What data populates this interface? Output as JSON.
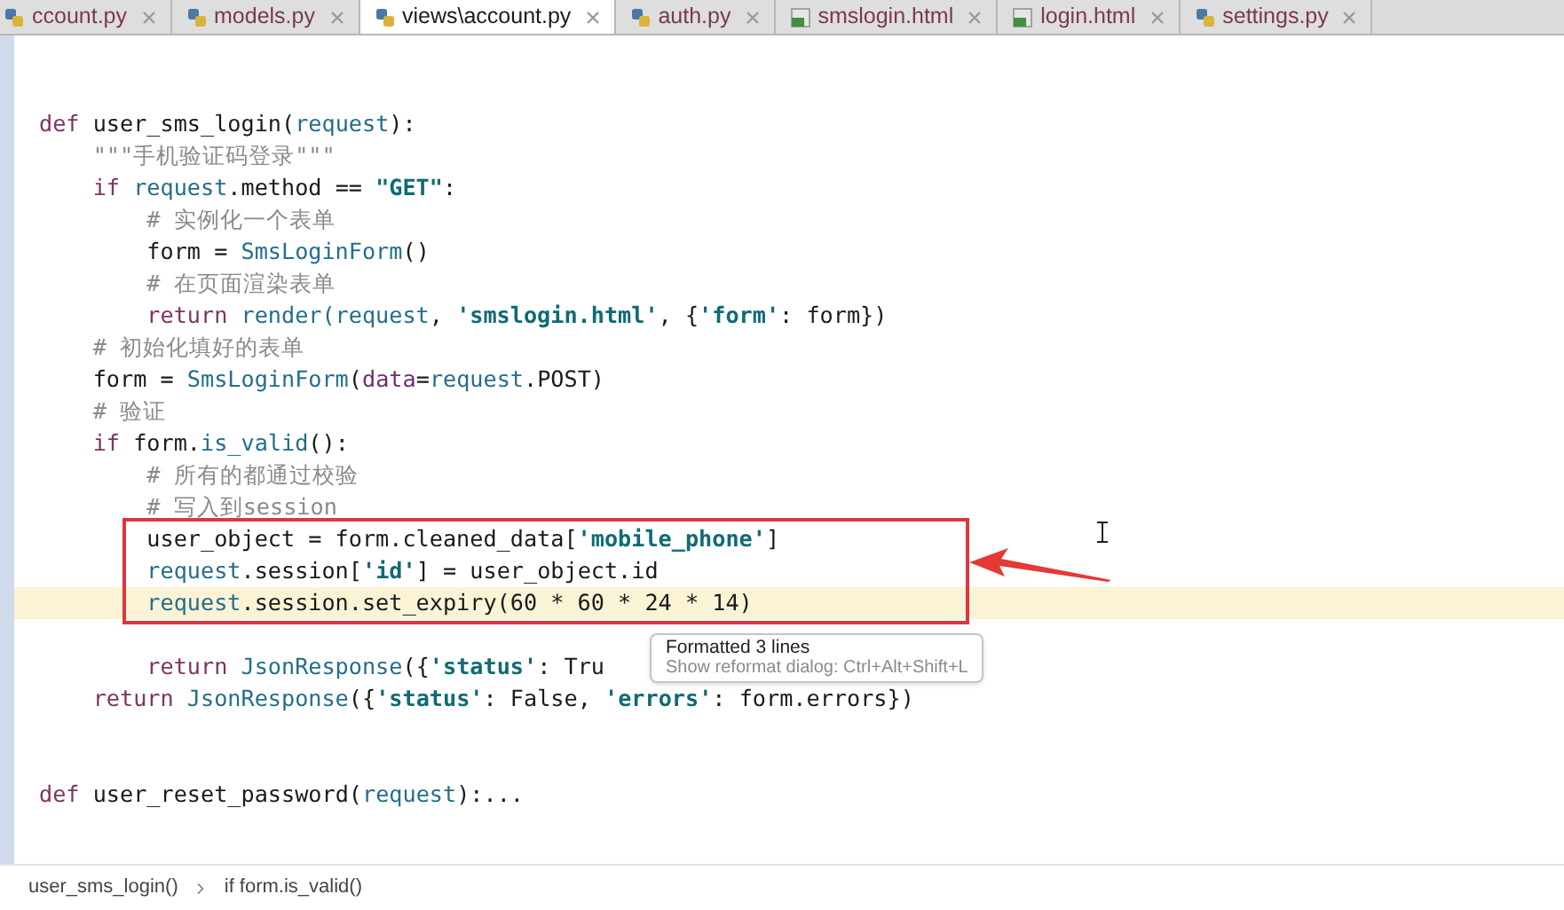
{
  "tabs": [
    {
      "label": "ccount.py",
      "selected": false,
      "kind": "python"
    },
    {
      "label": "models.py",
      "selected": false,
      "kind": "python"
    },
    {
      "label": "views\\account.py",
      "selected": true,
      "kind": "python"
    },
    {
      "label": "auth.py",
      "selected": false,
      "kind": "python"
    },
    {
      "label": "smslogin.html",
      "selected": false,
      "kind": "html"
    },
    {
      "label": "login.html",
      "selected": false,
      "kind": "html"
    },
    {
      "label": "settings.py",
      "selected": false,
      "kind": "python"
    }
  ],
  "editor": {
    "lines": [
      {
        "kind": "blank"
      },
      {
        "kind": "blank"
      },
      {
        "kind": "code",
        "tokens": [
          {
            "kind": "kw",
            "text": "def "
          },
          {
            "kind": "plain",
            "text": "user_sms_login("
          },
          {
            "kind": "name",
            "text": "request"
          },
          {
            "kind": "plain",
            "text": "):"
          }
        ],
        "current": false,
        "boxed": false
      },
      {
        "kind": "code",
        "tokens": [
          {
            "kind": "comment",
            "text": "    \"\"\"手机验证码登录\"\"\""
          }
        ],
        "current": false,
        "boxed": false
      },
      {
        "kind": "code",
        "tokens": [
          {
            "kind": "kw",
            "text": "    if "
          },
          {
            "kind": "name",
            "text": "request"
          },
          {
            "kind": "plain",
            "text": ".method == "
          },
          {
            "kind": "str",
            "text": "\"GET\""
          },
          {
            "kind": "plain",
            "text": ":"
          }
        ],
        "current": false,
        "boxed": false
      },
      {
        "kind": "code",
        "tokens": [
          {
            "kind": "comment",
            "text": "        # 实例化一个表单"
          }
        ],
        "current": false,
        "boxed": false
      },
      {
        "kind": "code",
        "tokens": [
          {
            "kind": "plain",
            "text": "        form = "
          },
          {
            "kind": "name",
            "text": "SmsLoginForm"
          },
          {
            "kind": "plain",
            "text": "()"
          }
        ],
        "current": false,
        "boxed": false
      },
      {
        "kind": "code",
        "tokens": [
          {
            "kind": "comment",
            "text": "        # 在页面渲染表单"
          }
        ],
        "current": false,
        "boxed": false
      },
      {
        "kind": "code",
        "tokens": [
          {
            "kind": "kw",
            "text": "        return "
          },
          {
            "kind": "name",
            "text": "render(request"
          },
          {
            "kind": "plain",
            "text": ", "
          },
          {
            "kind": "str",
            "text": "'smslogin.html'"
          },
          {
            "kind": "plain",
            "text": ", {"
          },
          {
            "kind": "str",
            "text": "'form'"
          },
          {
            "kind": "plain",
            "text": ": form})"
          }
        ],
        "current": false,
        "boxed": false
      },
      {
        "kind": "code",
        "tokens": [
          {
            "kind": "comment",
            "text": "    # 初始化填好的表单"
          }
        ],
        "current": false,
        "boxed": false
      },
      {
        "kind": "code",
        "tokens": [
          {
            "kind": "plain",
            "text": "    form = "
          },
          {
            "kind": "name",
            "text": "SmsLoginForm"
          },
          {
            "kind": "plain",
            "text": "("
          },
          {
            "kind": "param",
            "text": "data"
          },
          {
            "kind": "plain",
            "text": "="
          },
          {
            "kind": "name",
            "text": "request"
          },
          {
            "kind": "plain",
            "text": ".POST)"
          }
        ],
        "current": false,
        "boxed": false
      },
      {
        "kind": "code",
        "tokens": [
          {
            "kind": "comment",
            "text": "    # 验证"
          }
        ],
        "current": false,
        "boxed": false
      },
      {
        "kind": "code",
        "tokens": [
          {
            "kind": "kw",
            "text": "    if "
          },
          {
            "kind": "plain",
            "text": "form."
          },
          {
            "kind": "name",
            "text": "is_valid"
          },
          {
            "kind": "plain",
            "text": "():"
          }
        ],
        "current": false,
        "boxed": false
      },
      {
        "kind": "code",
        "tokens": [
          {
            "kind": "comment",
            "text": "        # 所有的都通过校验"
          }
        ],
        "current": false,
        "boxed": false
      },
      {
        "kind": "code",
        "tokens": [
          {
            "kind": "comment",
            "text": "        # 写入到session"
          }
        ],
        "current": false,
        "boxed": false
      },
      {
        "kind": "code",
        "tokens": [
          {
            "kind": "plain",
            "text": "        user_object = form.cleaned_data["
          },
          {
            "kind": "str",
            "text": "'mobile_phone'"
          },
          {
            "kind": "plain",
            "text": "]"
          }
        ],
        "current": false,
        "boxed": true
      },
      {
        "kind": "code",
        "tokens": [
          {
            "kind": "name",
            "text": "        request"
          },
          {
            "kind": "plain",
            "text": ".session["
          },
          {
            "kind": "str",
            "text": "'id'"
          },
          {
            "kind": "plain",
            "text": "] = user_object.id"
          }
        ],
        "current": false,
        "boxed": true
      },
      {
        "kind": "code",
        "tokens": [
          {
            "kind": "name",
            "text": "        request"
          },
          {
            "kind": "plain",
            "text": ".session.set_expiry(60 * 60 * 24 * 14)"
          }
        ],
        "current": true,
        "boxed": true
      },
      {
        "kind": "blank"
      },
      {
        "kind": "code",
        "tokens": [
          {
            "kind": "kw",
            "text": "        return "
          },
          {
            "kind": "name",
            "text": "JsonResponse"
          },
          {
            "kind": "plain",
            "text": "({"
          },
          {
            "kind": "str",
            "text": "'status'"
          },
          {
            "kind": "plain",
            "text": ": Tru"
          }
        ],
        "current": false,
        "boxed": false
      },
      {
        "kind": "code",
        "tokens": [
          {
            "kind": "kw",
            "text": "    return "
          },
          {
            "kind": "name",
            "text": "JsonResponse"
          },
          {
            "kind": "plain",
            "text": "({"
          },
          {
            "kind": "str",
            "text": "'status'"
          },
          {
            "kind": "plain",
            "text": ": False, "
          },
          {
            "kind": "str",
            "text": "'errors'"
          },
          {
            "kind": "plain",
            "text": ": form.errors})"
          }
        ],
        "current": false,
        "boxed": false
      },
      {
        "kind": "blank"
      },
      {
        "kind": "blank"
      },
      {
        "kind": "code",
        "tokens": [
          {
            "kind": "kw",
            "text": "def "
          },
          {
            "kind": "plain",
            "text": "user_reset_password("
          },
          {
            "kind": "name",
            "text": "request"
          },
          {
            "kind": "plain",
            "text": "):..."
          }
        ],
        "current": false,
        "boxed": false
      }
    ]
  },
  "tooltip": {
    "title": "Formatted 3 lines",
    "hint": "Show reformat dialog: Ctrl+Alt+Shift+L"
  },
  "breadcrumbs": [
    "user_sms_login()",
    "if form.is_valid()"
  ]
}
